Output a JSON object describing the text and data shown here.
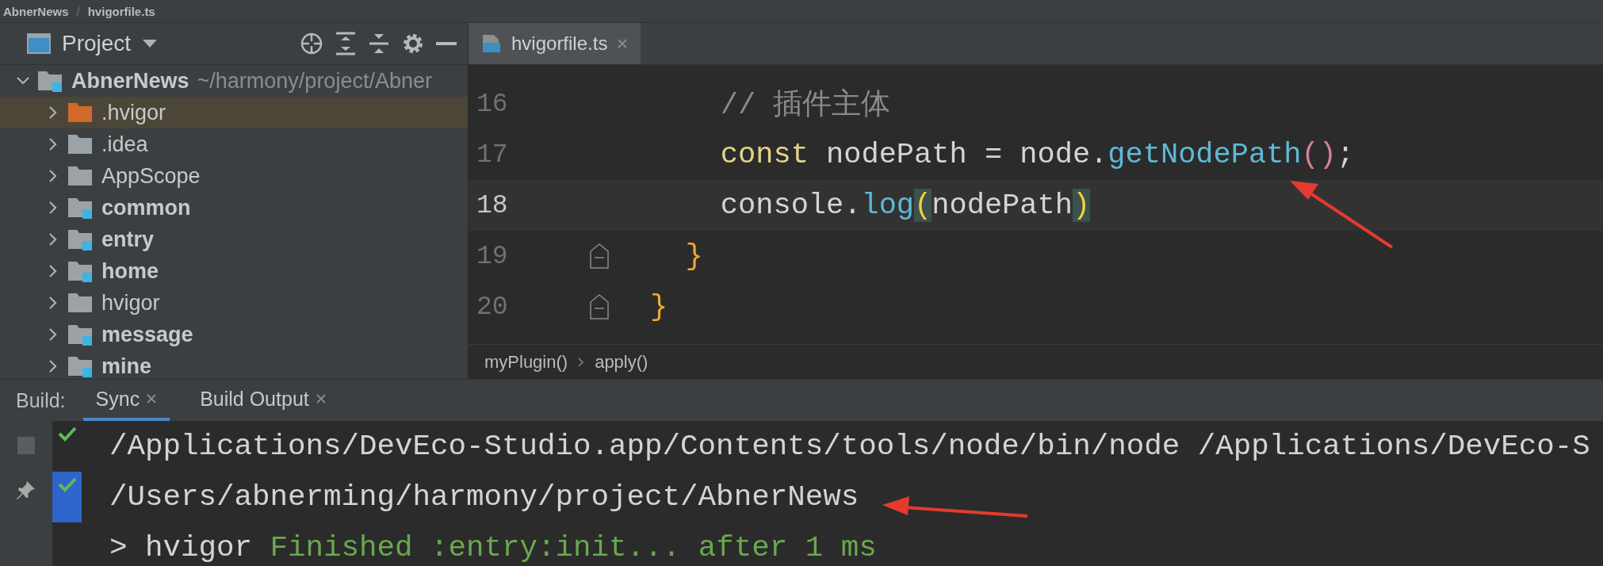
{
  "nav_bar": {
    "project": "AbnerNews",
    "separator": "/",
    "file": "hvigorfile.ts"
  },
  "project_panel": {
    "title": "Project",
    "root": {
      "name": "AbnerNews",
      "path": "~/harmony/project/Abner",
      "expanded": true,
      "children": [
        {
          "name": ".hvigor",
          "kind": "excluded",
          "selected": true,
          "expanded": false
        },
        {
          "name": ".idea",
          "kind": "folder",
          "selected": false,
          "expanded": false
        },
        {
          "name": "AppScope",
          "kind": "folder",
          "selected": false,
          "expanded": false
        },
        {
          "name": "common",
          "kind": "module",
          "selected": false,
          "expanded": false
        },
        {
          "name": "entry",
          "kind": "module",
          "selected": false,
          "expanded": false
        },
        {
          "name": "home",
          "kind": "module",
          "selected": false,
          "expanded": false
        },
        {
          "name": "hvigor",
          "kind": "folder",
          "selected": false,
          "expanded": false
        },
        {
          "name": "message",
          "kind": "module",
          "selected": false,
          "expanded": false
        },
        {
          "name": "mine",
          "kind": "module",
          "selected": false,
          "expanded": false
        }
      ]
    }
  },
  "editor": {
    "tabs": [
      {
        "label": "hvigorfile.ts",
        "selected": true
      }
    ],
    "lines": [
      {
        "number": "16",
        "current": false,
        "fold": false,
        "tokens": [
          {
            "kind": "comment",
            "text": "    // 插件主体"
          }
        ]
      },
      {
        "number": "17",
        "current": false,
        "fold": false,
        "tokens": [
          {
            "kind": "keyword",
            "text": "    const"
          },
          {
            "kind": "plain",
            "text": " nodePath = node."
          },
          {
            "kind": "method",
            "text": "getNodePath"
          },
          {
            "kind": "paren",
            "text": "()"
          },
          {
            "kind": "plain",
            "text": ";"
          }
        ]
      },
      {
        "number": "18",
        "current": true,
        "fold": false,
        "tokens": [
          {
            "kind": "plain",
            "text": "    console."
          },
          {
            "kind": "method",
            "text": "log"
          },
          {
            "kind": "match",
            "text": "("
          },
          {
            "kind": "plain",
            "text": "nodePath"
          },
          {
            "kind": "match",
            "text": ")"
          }
        ]
      },
      {
        "number": "19",
        "current": false,
        "fold": true,
        "tokens": [
          {
            "kind": "brace",
            "text": "  }"
          }
        ]
      },
      {
        "number": "20",
        "current": false,
        "fold": true,
        "tokens": [
          {
            "kind": "brace",
            "text": "}"
          }
        ]
      }
    ],
    "breadcrumbs": [
      "myPlugin()",
      "apply()"
    ]
  },
  "build": {
    "label": "Build:",
    "tabs": [
      {
        "label": "Sync",
        "selected": true
      },
      {
        "label": "Build Output",
        "selected": false
      }
    ],
    "output": [
      {
        "done": true,
        "selected": false,
        "tokens": [
          {
            "kind": "plain",
            "text": "/Applications/DevEco-Studio.app/Contents/tools/node/bin/node /Applications/DevEco-S"
          }
        ]
      },
      {
        "done": true,
        "selected": true,
        "tokens": [
          {
            "kind": "plain",
            "text": "/Users/abnerming/harmony/project/AbnerNews"
          }
        ]
      },
      {
        "done": false,
        "selected": false,
        "tokens": [
          {
            "kind": "plain",
            "text": "> hvigor "
          },
          {
            "kind": "success",
            "text": "Finished :entry:init... after 1 ms"
          }
        ]
      }
    ]
  }
}
